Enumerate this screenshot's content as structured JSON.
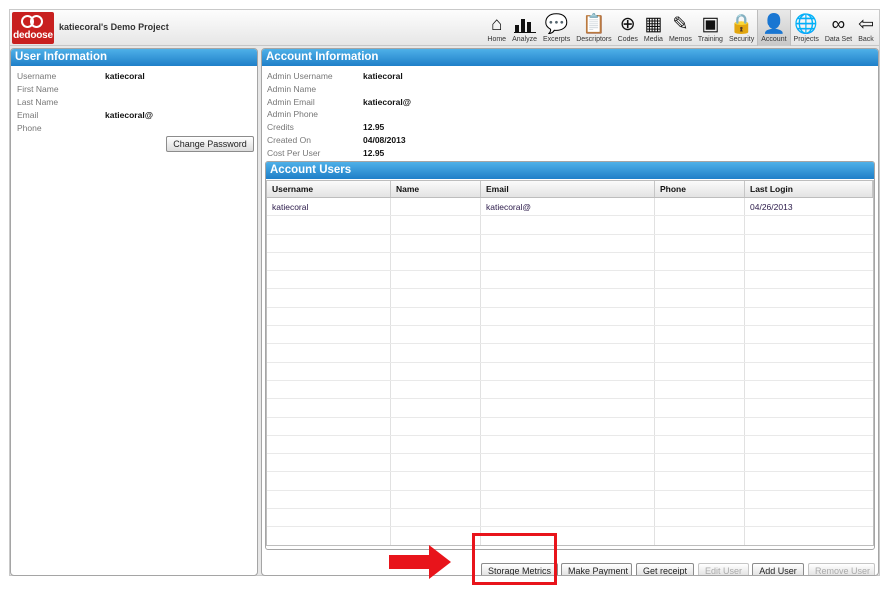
{
  "app": {
    "logo_text": "dedoose",
    "project_title": "katiecoral's Demo Project"
  },
  "nav": [
    {
      "label": "Home",
      "icon": "home-icon",
      "glyph": "⌂"
    },
    {
      "label": "Analyze",
      "icon": "bar-chart-icon",
      "glyph": ""
    },
    {
      "label": "Excerpts",
      "icon": "speech-bubble-icon",
      "glyph": "💬"
    },
    {
      "label": "Descriptors",
      "icon": "clipboard-icon",
      "glyph": "📋"
    },
    {
      "label": "Codes",
      "icon": "plus-circle-icon",
      "glyph": "⊕"
    },
    {
      "label": "Media",
      "icon": "media-icon",
      "glyph": "▦"
    },
    {
      "label": "Memos",
      "icon": "memo-icon",
      "glyph": "✎"
    },
    {
      "label": "Training",
      "icon": "training-icon",
      "glyph": "▣"
    },
    {
      "label": "Security",
      "icon": "lock-icon",
      "glyph": "🔒"
    },
    {
      "label": "Account",
      "icon": "user-icon",
      "glyph": "👤",
      "active": true
    },
    {
      "label": "Projects",
      "icon": "globe-icon",
      "glyph": "🌐"
    },
    {
      "label": "Data Set",
      "icon": "binoculars-icon",
      "glyph": "∞"
    },
    {
      "label": "Back",
      "icon": "back-arrow-icon",
      "glyph": "⇦"
    }
  ],
  "user_info": {
    "title": "User Information",
    "fields": [
      {
        "label": "Username",
        "value": "katiecoral"
      },
      {
        "label": "First Name",
        "value": ""
      },
      {
        "label": "Last Name",
        "value": ""
      },
      {
        "label": "Email",
        "value": "katiecoral@"
      },
      {
        "label": "Phone",
        "value": ""
      }
    ],
    "change_password": "Change Password"
  },
  "account_info": {
    "title": "Account Information",
    "fields": [
      {
        "label": "Admin Username",
        "value": "katiecoral"
      },
      {
        "label": "Admin Name",
        "value": ""
      },
      {
        "label": "Admin Email",
        "value": "katiecoral@"
      },
      {
        "label": "Admin Phone",
        "value": ""
      },
      {
        "label": "Credits",
        "value": "12.95"
      },
      {
        "label": "Created On",
        "value": "04/08/2013"
      },
      {
        "label": "Cost Per User",
        "value": "12.95"
      }
    ]
  },
  "account_users": {
    "title": "Account Users",
    "columns": [
      "Username",
      "Name",
      "Email",
      "Phone",
      "Last Login"
    ],
    "rows": [
      [
        "katiecoral",
        "",
        "katiecoral@",
        "",
        "04/26/2013"
      ]
    ],
    "empty_rows": 18
  },
  "buttons": {
    "storage_metrics": "Storage Metrics",
    "make_payment": "Make Payment",
    "get_receipt": "Get receipt",
    "edit_user": "Edit User",
    "add_user": "Add User",
    "remove_user": "Remove User"
  },
  "colors": {
    "brand_red": "#c8201f",
    "header_blue": "#2a8fd5",
    "annotation_red": "#e8141b"
  }
}
